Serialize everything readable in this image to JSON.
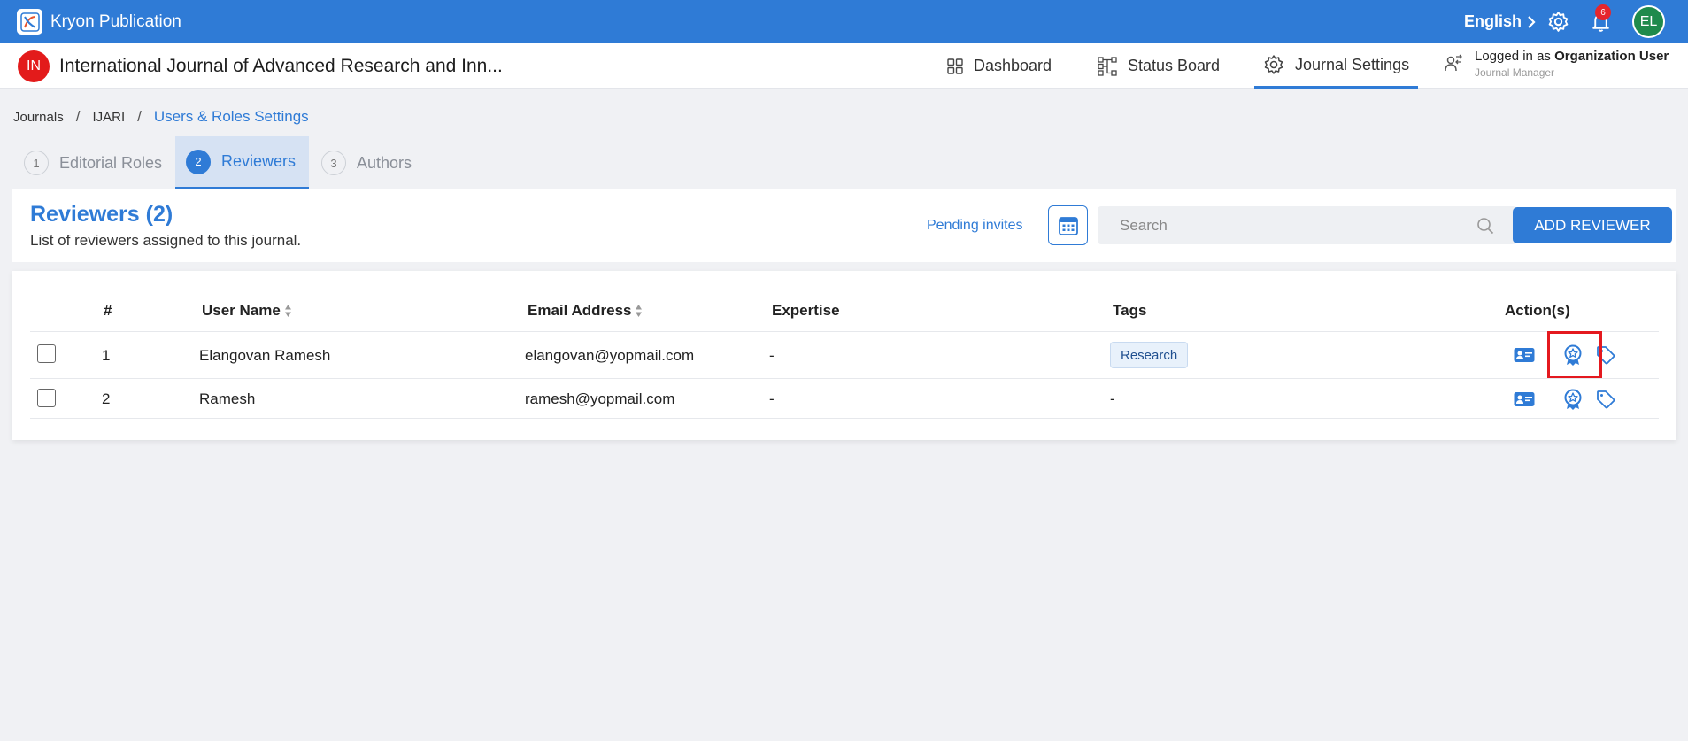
{
  "app": {
    "title": "Kryon Publication",
    "language": "English",
    "notification_count": "6",
    "user_initials": "EL"
  },
  "journal": {
    "avatar": "IN",
    "title": "International Journal of Advanced Research and Inn...",
    "nav": {
      "dashboard": "Dashboard",
      "status_board": "Status Board",
      "journal_settings": "Journal Settings"
    },
    "logged_in_prefix": "Logged in as",
    "logged_in_user": "Organization User",
    "logged_in_role": "Journal Manager"
  },
  "breadcrumb": {
    "items": [
      "Journals",
      "IJARI",
      "Users & Roles Settings"
    ],
    "separator": "/"
  },
  "tabs": [
    {
      "num": "1",
      "label": "Editorial Roles"
    },
    {
      "num": "2",
      "label": "Reviewers"
    },
    {
      "num": "3",
      "label": "Authors"
    }
  ],
  "reviewers": {
    "title": "Reviewers (2)",
    "subtitle": "List of reviewers assigned to this journal.",
    "pending_invites": "Pending invites",
    "search_placeholder": "Search",
    "add_button": "ADD REVIEWER"
  },
  "table": {
    "headers": {
      "num": "#",
      "user_name": "User Name",
      "email": "Email Address",
      "expertise": "Expertise",
      "tags": "Tags",
      "actions": "Action(s)"
    },
    "rows": [
      {
        "num": "1",
        "name": "Elangovan Ramesh",
        "email": "elangovan@yopmail.com",
        "expertise": "-",
        "tag": "Research"
      },
      {
        "num": "2",
        "name": "Ramesh",
        "email": "ramesh@yopmail.com",
        "expertise": "-",
        "tag": "-"
      }
    ]
  },
  "colors": {
    "primary": "#2f7bd6",
    "topbar": "#2f7bd6",
    "highlight": "#e4191f",
    "avatar_user": "#1f8a4c",
    "avatar_journal": "#e31b1b"
  },
  "icons": [
    "app-logo-icon",
    "chevron-right-icon",
    "gear-icon",
    "bell-icon",
    "dashboard-icon",
    "status-board-icon",
    "settings-gear-icon",
    "user-switch-icon",
    "calendar-grid-icon",
    "search-icon",
    "sort-icon",
    "id-card-icon",
    "award-badge-icon",
    "tag-icon"
  ]
}
